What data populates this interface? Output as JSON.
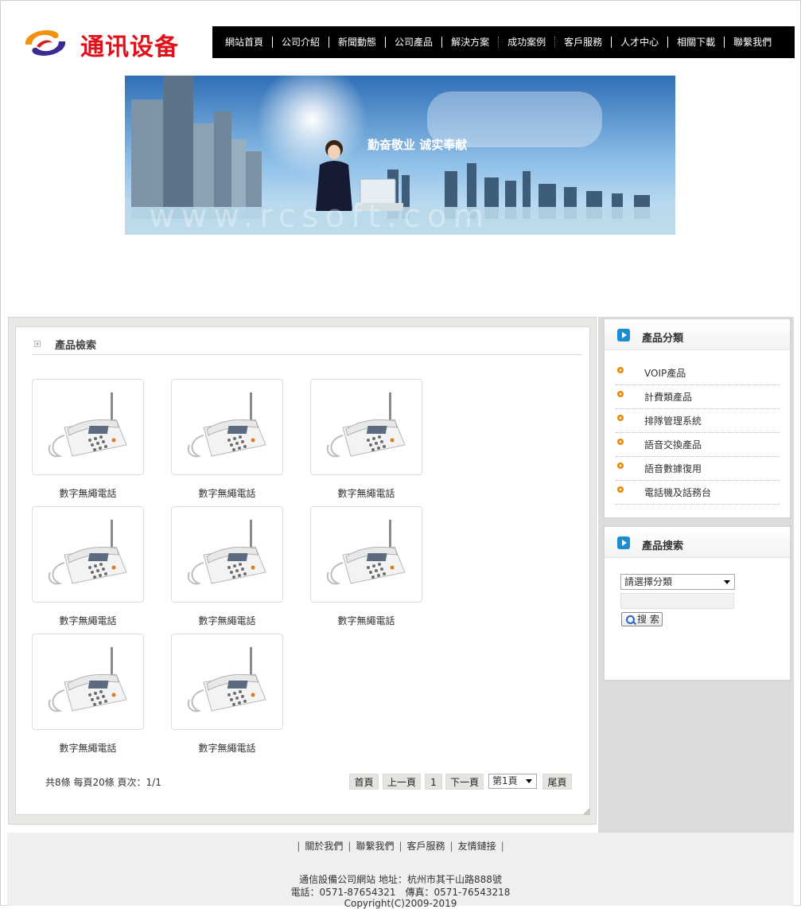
{
  "header": {
    "logo_text": "通讯设备",
    "nav": [
      "網站首頁",
      "公司介紹",
      "新聞動態",
      "公司產品",
      "解決方案",
      "成功案例",
      "客戶服務",
      "人才中心",
      "相關下載",
      "聯繫我們"
    ]
  },
  "banner": {
    "slogan": "勤奋敬业 诚实奉献",
    "watermark": "www.rcsoft.com"
  },
  "main": {
    "title": "產品檢索",
    "products": [
      {
        "name": "數字無繩電話"
      },
      {
        "name": "數字無繩電話"
      },
      {
        "name": "數字無繩電話"
      },
      {
        "name": "數字無繩電話"
      },
      {
        "name": "數字無繩電話"
      },
      {
        "name": "數字無繩電話"
      },
      {
        "name": "數字無繩電話"
      },
      {
        "name": "數字無繩電話"
      }
    ],
    "pager": {
      "info": "共8條 每頁20條 頁次：1/1",
      "first": "首頁",
      "prev": "上一頁",
      "current": "1",
      "next": "下一頁",
      "page_select": "第1頁",
      "last": "尾頁"
    }
  },
  "sidebar": {
    "categories_title": "產品分類",
    "categories": [
      "VOIP產品",
      "計費類產品",
      "排隊管理系統",
      "語音交換產品",
      "語音數據復用",
      "電話機及話務台"
    ],
    "search_title": "產品搜索",
    "search_select": "請選擇分類",
    "search_button": "搜 索"
  },
  "footer": {
    "links": [
      "關於我們",
      "聯繫我們",
      "客戶服務",
      "友情鏈接"
    ],
    "line1": "通信設備公司網站 地址：杭州市其干山路888號",
    "line2": "電話：0571-87654321　傳真：0571-76543218",
    "line3": "Copyright(C)2009-2019"
  },
  "colors": {
    "brand_red": "#e1101a",
    "nav_bg": "#000000",
    "accent_orange": "#e8890b",
    "accent_blue": "#1b8dd4"
  }
}
